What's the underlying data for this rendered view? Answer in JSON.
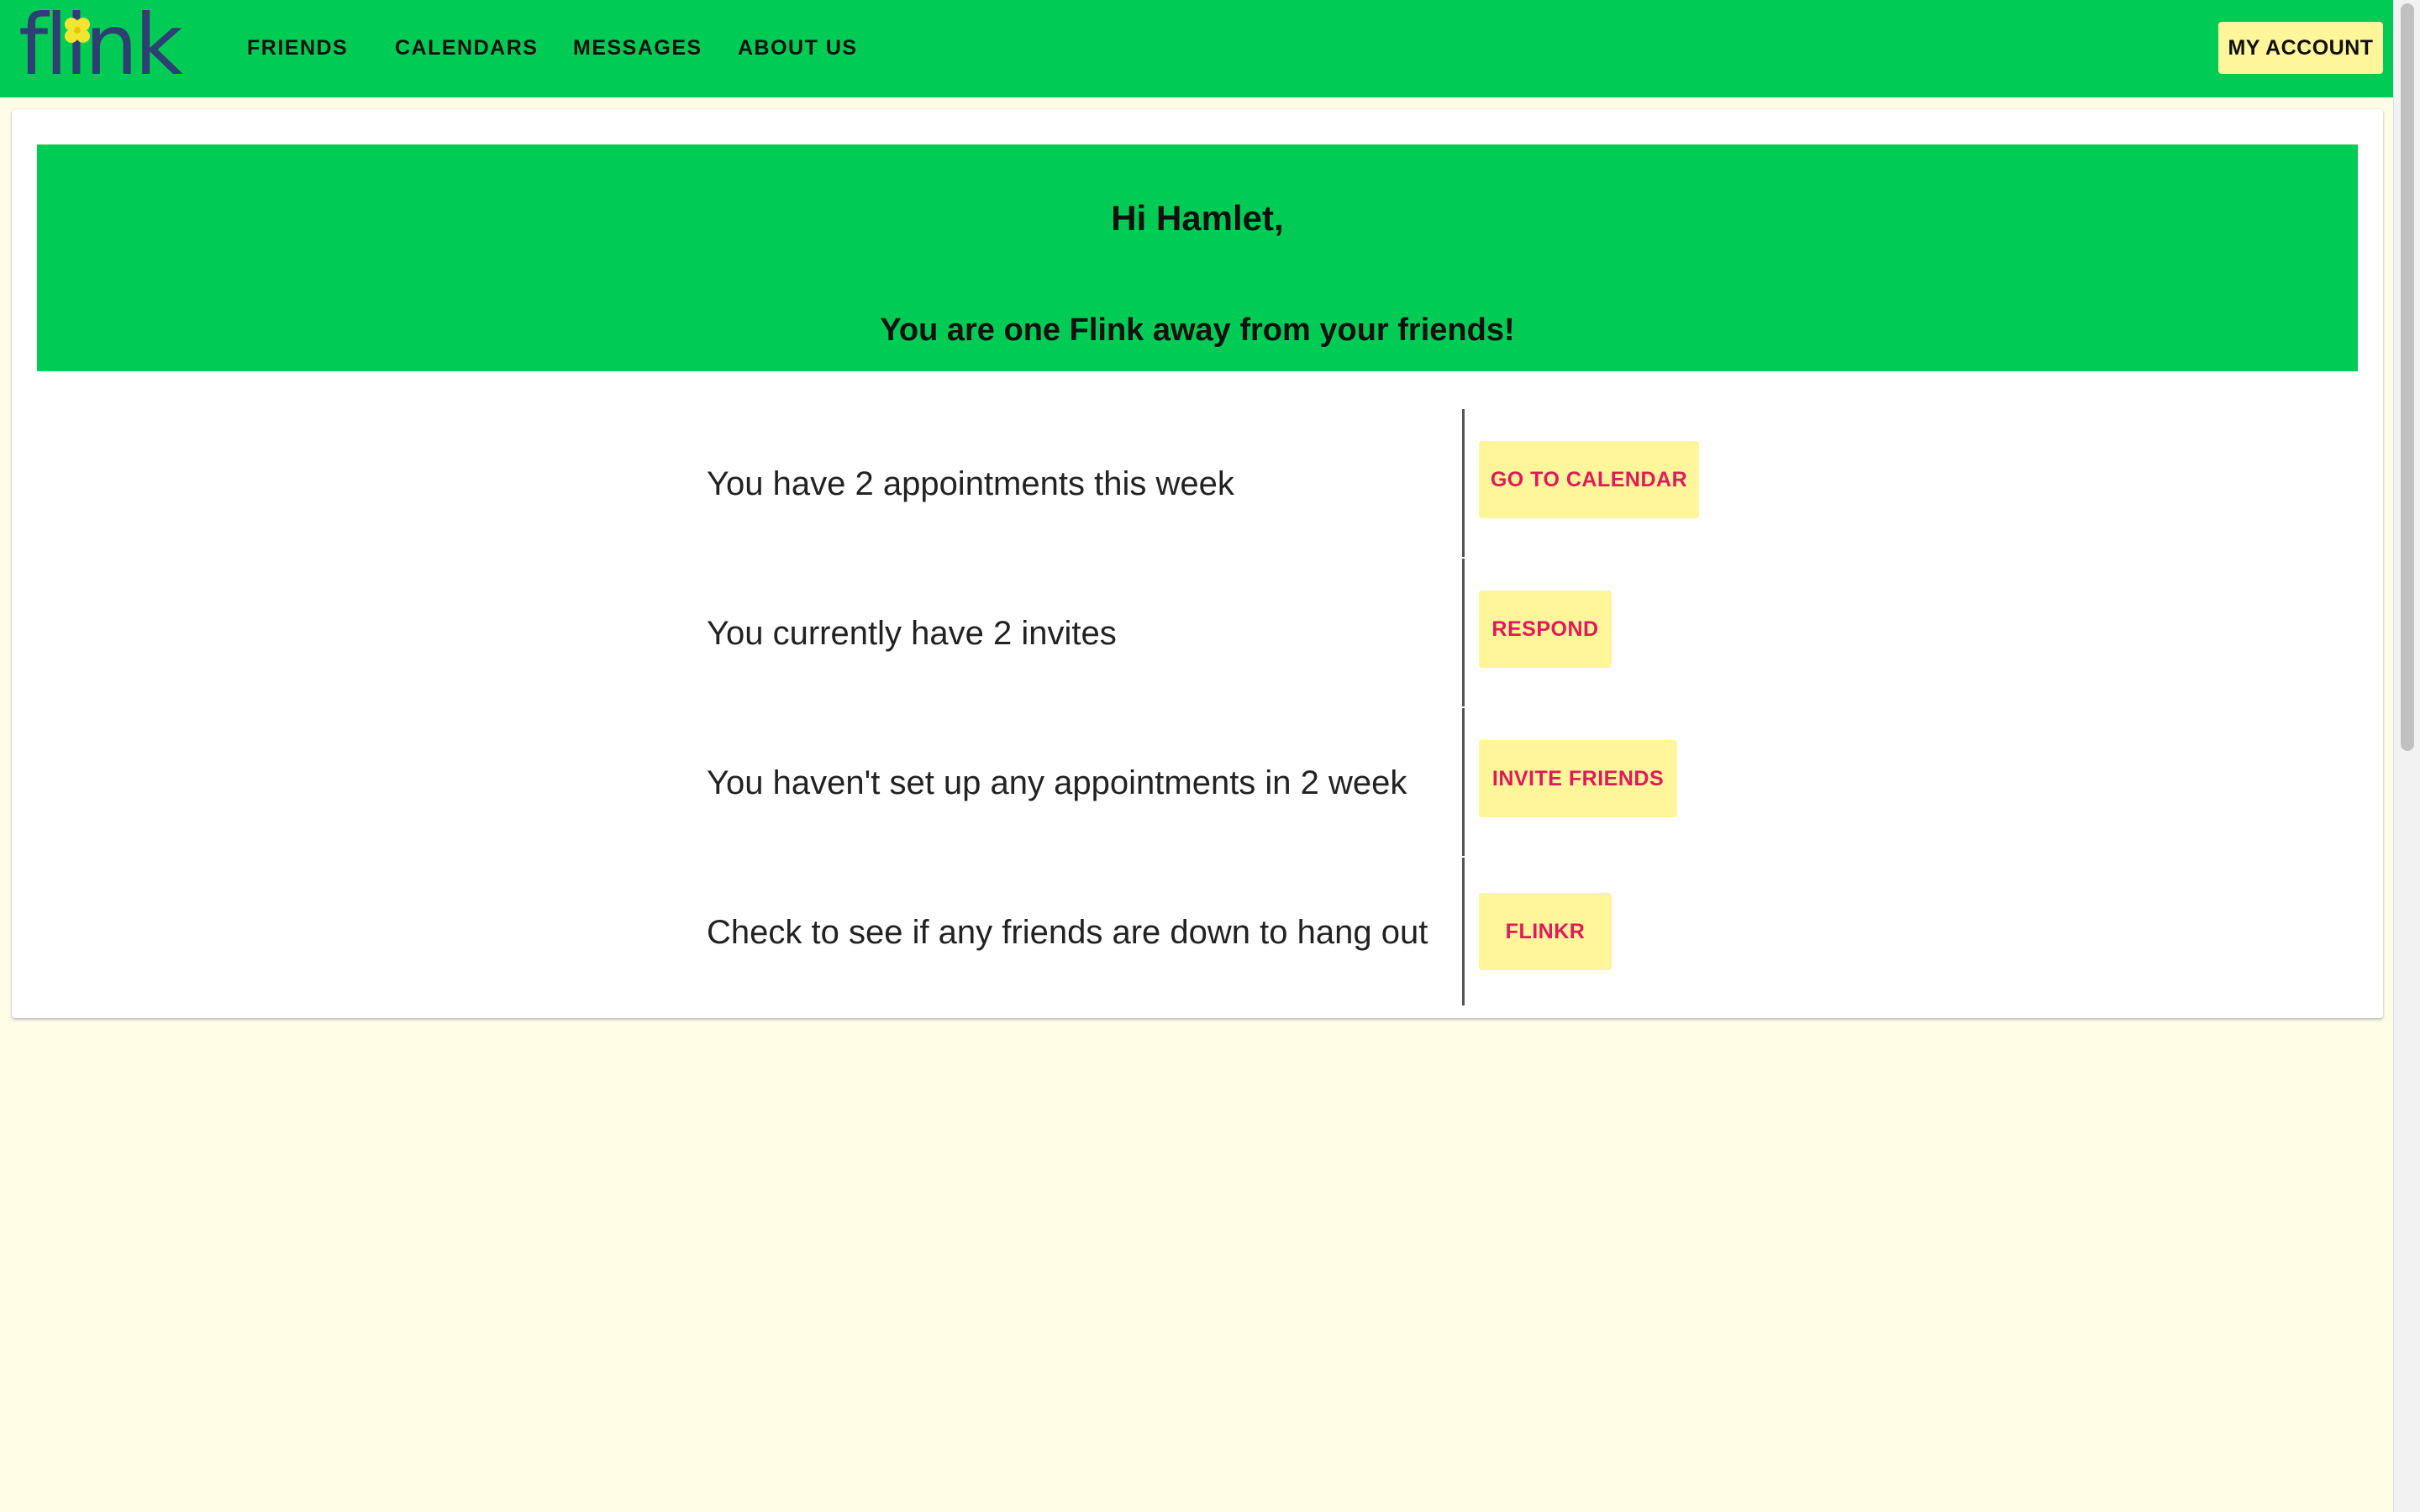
{
  "brand": {
    "logo_text": "flink",
    "accent": "#00cc55",
    "button_bg": "#fff59a",
    "button_text": "#e0195a",
    "page_bg": "#fffde6"
  },
  "nav": {
    "items": [
      {
        "label": "FRIENDS"
      },
      {
        "label": "CALENDARS"
      },
      {
        "label": "MESSAGES"
      },
      {
        "label": "ABOUT US"
      }
    ],
    "account_label": "MY ACCOUNT"
  },
  "hero": {
    "greeting": "Hi Hamlet,",
    "subtitle": "You are one Flink away from your friends!"
  },
  "rows": [
    {
      "text": "You have 2 appointments this week",
      "button": "GO TO CALENDAR"
    },
    {
      "text": "You currently have 2 invites",
      "button": "RESPOND"
    },
    {
      "text": "You haven't set up any appointments in 2 week",
      "button": "INVITE FRIENDS"
    },
    {
      "text": "Check to see if any friends are down to hang out",
      "button": "FLINKR"
    }
  ]
}
